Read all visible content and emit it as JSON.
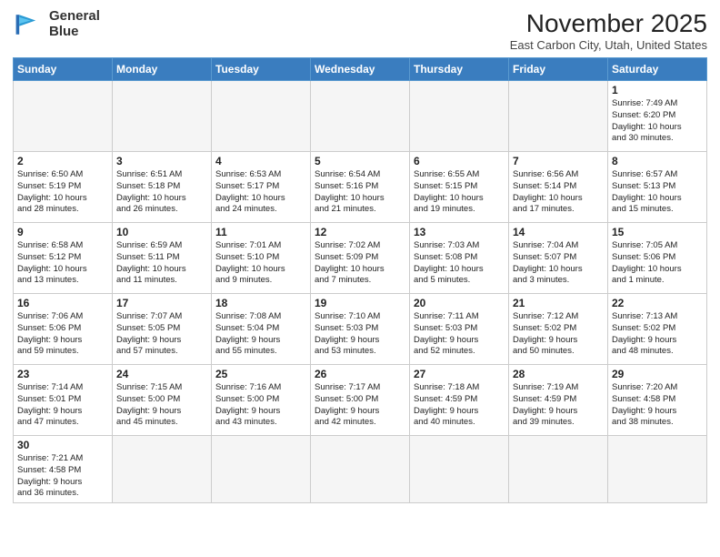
{
  "logo": {
    "line1": "General",
    "line2": "Blue"
  },
  "title": "November 2025",
  "location": "East Carbon City, Utah, United States",
  "days_of_week": [
    "Sunday",
    "Monday",
    "Tuesday",
    "Wednesday",
    "Thursday",
    "Friday",
    "Saturday"
  ],
  "weeks": [
    [
      {
        "day": "",
        "info": ""
      },
      {
        "day": "",
        "info": ""
      },
      {
        "day": "",
        "info": ""
      },
      {
        "day": "",
        "info": ""
      },
      {
        "day": "",
        "info": ""
      },
      {
        "day": "",
        "info": ""
      },
      {
        "day": "1",
        "info": "Sunrise: 7:49 AM\nSunset: 6:20 PM\nDaylight: 10 hours\nand 30 minutes."
      }
    ],
    [
      {
        "day": "2",
        "info": "Sunrise: 6:50 AM\nSunset: 5:19 PM\nDaylight: 10 hours\nand 28 minutes."
      },
      {
        "day": "3",
        "info": "Sunrise: 6:51 AM\nSunset: 5:18 PM\nDaylight: 10 hours\nand 26 minutes."
      },
      {
        "day": "4",
        "info": "Sunrise: 6:53 AM\nSunset: 5:17 PM\nDaylight: 10 hours\nand 24 minutes."
      },
      {
        "day": "5",
        "info": "Sunrise: 6:54 AM\nSunset: 5:16 PM\nDaylight: 10 hours\nand 21 minutes."
      },
      {
        "day": "6",
        "info": "Sunrise: 6:55 AM\nSunset: 5:15 PM\nDaylight: 10 hours\nand 19 minutes."
      },
      {
        "day": "7",
        "info": "Sunrise: 6:56 AM\nSunset: 5:14 PM\nDaylight: 10 hours\nand 17 minutes."
      },
      {
        "day": "8",
        "info": "Sunrise: 6:57 AM\nSunset: 5:13 PM\nDaylight: 10 hours\nand 15 minutes."
      }
    ],
    [
      {
        "day": "9",
        "info": "Sunrise: 6:58 AM\nSunset: 5:12 PM\nDaylight: 10 hours\nand 13 minutes."
      },
      {
        "day": "10",
        "info": "Sunrise: 6:59 AM\nSunset: 5:11 PM\nDaylight: 10 hours\nand 11 minutes."
      },
      {
        "day": "11",
        "info": "Sunrise: 7:01 AM\nSunset: 5:10 PM\nDaylight: 10 hours\nand 9 minutes."
      },
      {
        "day": "12",
        "info": "Sunrise: 7:02 AM\nSunset: 5:09 PM\nDaylight: 10 hours\nand 7 minutes."
      },
      {
        "day": "13",
        "info": "Sunrise: 7:03 AM\nSunset: 5:08 PM\nDaylight: 10 hours\nand 5 minutes."
      },
      {
        "day": "14",
        "info": "Sunrise: 7:04 AM\nSunset: 5:07 PM\nDaylight: 10 hours\nand 3 minutes."
      },
      {
        "day": "15",
        "info": "Sunrise: 7:05 AM\nSunset: 5:06 PM\nDaylight: 10 hours\nand 1 minute."
      }
    ],
    [
      {
        "day": "16",
        "info": "Sunrise: 7:06 AM\nSunset: 5:06 PM\nDaylight: 9 hours\nand 59 minutes."
      },
      {
        "day": "17",
        "info": "Sunrise: 7:07 AM\nSunset: 5:05 PM\nDaylight: 9 hours\nand 57 minutes."
      },
      {
        "day": "18",
        "info": "Sunrise: 7:08 AM\nSunset: 5:04 PM\nDaylight: 9 hours\nand 55 minutes."
      },
      {
        "day": "19",
        "info": "Sunrise: 7:10 AM\nSunset: 5:03 PM\nDaylight: 9 hours\nand 53 minutes."
      },
      {
        "day": "20",
        "info": "Sunrise: 7:11 AM\nSunset: 5:03 PM\nDaylight: 9 hours\nand 52 minutes."
      },
      {
        "day": "21",
        "info": "Sunrise: 7:12 AM\nSunset: 5:02 PM\nDaylight: 9 hours\nand 50 minutes."
      },
      {
        "day": "22",
        "info": "Sunrise: 7:13 AM\nSunset: 5:02 PM\nDaylight: 9 hours\nand 48 minutes."
      }
    ],
    [
      {
        "day": "23",
        "info": "Sunrise: 7:14 AM\nSunset: 5:01 PM\nDaylight: 9 hours\nand 47 minutes."
      },
      {
        "day": "24",
        "info": "Sunrise: 7:15 AM\nSunset: 5:00 PM\nDaylight: 9 hours\nand 45 minutes."
      },
      {
        "day": "25",
        "info": "Sunrise: 7:16 AM\nSunset: 5:00 PM\nDaylight: 9 hours\nand 43 minutes."
      },
      {
        "day": "26",
        "info": "Sunrise: 7:17 AM\nSunset: 5:00 PM\nDaylight: 9 hours\nand 42 minutes."
      },
      {
        "day": "27",
        "info": "Sunrise: 7:18 AM\nSunset: 4:59 PM\nDaylight: 9 hours\nand 40 minutes."
      },
      {
        "day": "28",
        "info": "Sunrise: 7:19 AM\nSunset: 4:59 PM\nDaylight: 9 hours\nand 39 minutes."
      },
      {
        "day": "29",
        "info": "Sunrise: 7:20 AM\nSunset: 4:58 PM\nDaylight: 9 hours\nand 38 minutes."
      }
    ],
    [
      {
        "day": "30",
        "info": "Sunrise: 7:21 AM\nSunset: 4:58 PM\nDaylight: 9 hours\nand 36 minutes."
      },
      {
        "day": "",
        "info": ""
      },
      {
        "day": "",
        "info": ""
      },
      {
        "day": "",
        "info": ""
      },
      {
        "day": "",
        "info": ""
      },
      {
        "day": "",
        "info": ""
      },
      {
        "day": "",
        "info": ""
      }
    ]
  ]
}
